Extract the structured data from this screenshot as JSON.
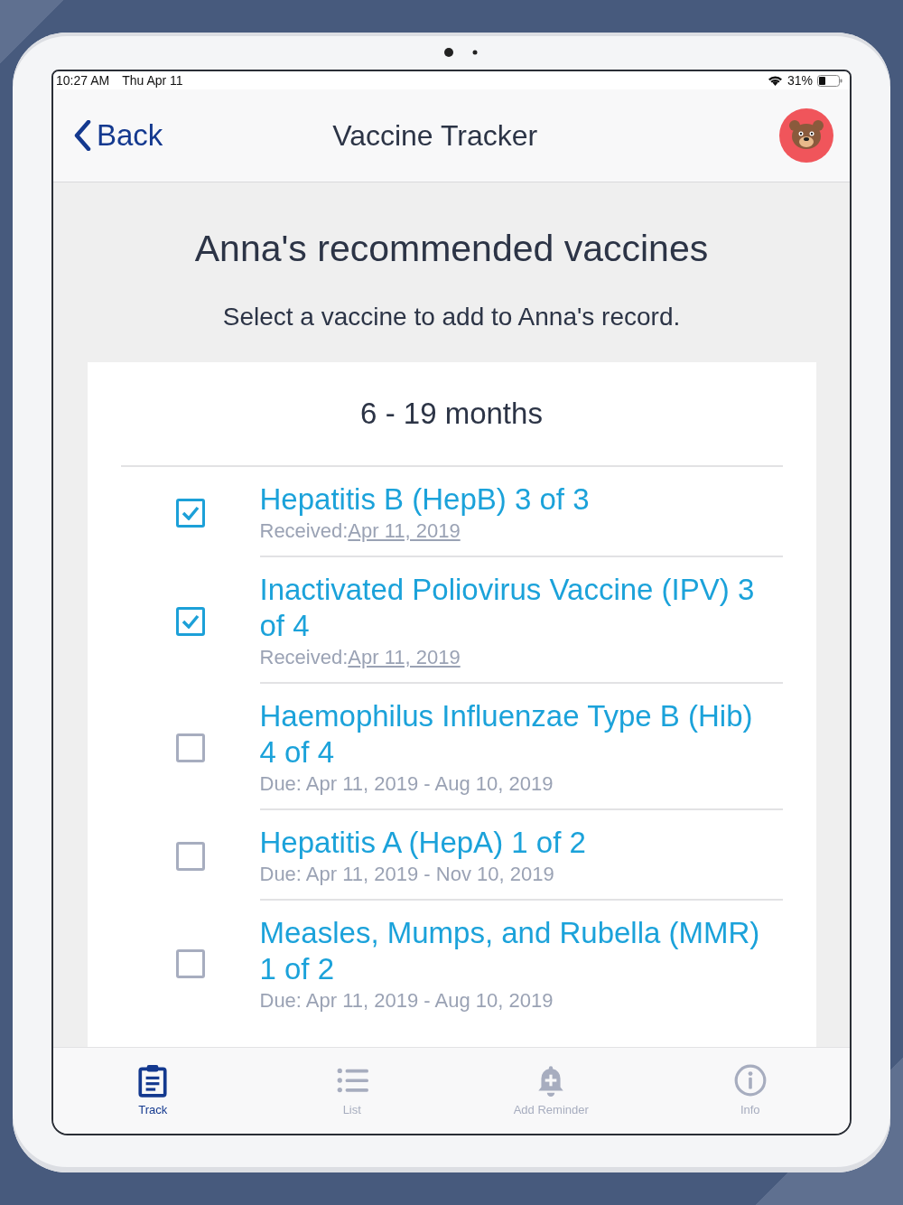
{
  "status_bar": {
    "time": "10:27 AM",
    "date": "Thu Apr 11",
    "battery": "31%"
  },
  "nav": {
    "back": "Back",
    "title": "Vaccine Tracker"
  },
  "heading": "Anna's recommended vaccines",
  "subtitle": "Select a vaccine to add to Anna's record.",
  "card": {
    "title": "6 - 19 months",
    "vaccines": [
      {
        "title": "Hepatitis B (HepB) 3 of 3",
        "checked": true,
        "kind": "received",
        "label": "Received:",
        "date": "Apr 11, 2019"
      },
      {
        "title": "Inactivated Poliovirus Vaccine (IPV) 3 of 4",
        "checked": true,
        "kind": "received",
        "label": "Received:",
        "date": "Apr 11, 2019"
      },
      {
        "title": "Haemophilus Influenzae Type B (Hib) 4 of 4",
        "checked": false,
        "kind": "due",
        "detail": "Due: Apr 11, 2019 - Aug 10, 2019"
      },
      {
        "title": "Hepatitis A (HepA) 1 of 2",
        "checked": false,
        "kind": "due",
        "detail": "Due: Apr 11, 2019 - Nov 10, 2019"
      },
      {
        "title": "Measles, Mumps, and Rubella (MMR) 1 of 2",
        "checked": false,
        "kind": "due",
        "detail": "Due: Apr 11, 2019 - Aug 10, 2019"
      }
    ]
  },
  "tabs": [
    {
      "label": "Track",
      "selected": true
    },
    {
      "label": "List",
      "selected": false
    },
    {
      "label": "Add Reminder",
      "selected": false
    },
    {
      "label": "Info",
      "selected": false
    }
  ]
}
